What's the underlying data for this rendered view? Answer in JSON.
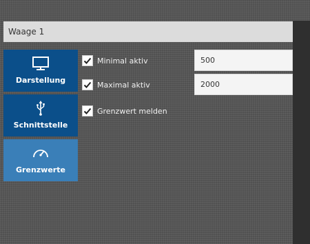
{
  "header": {
    "title": "Waage 1"
  },
  "nav": {
    "items": [
      {
        "label": "Darstellung",
        "icon": "monitor-icon",
        "active": false
      },
      {
        "label": "Schnittstelle",
        "icon": "usb-icon",
        "active": false
      },
      {
        "label": "Grenzwerte",
        "icon": "gauge-icon",
        "active": true
      }
    ]
  },
  "settings": {
    "min": {
      "label": "Minimal aktiv",
      "checked": true,
      "value": "500"
    },
    "max": {
      "label": "Maximal aktiv",
      "checked": true,
      "value": "2000"
    },
    "report": {
      "label": "Grenzwert melden",
      "checked": true
    }
  },
  "colors": {
    "tile": "#0b4f8a",
    "tile_active": "#3a7fb8",
    "background": "#575757"
  }
}
